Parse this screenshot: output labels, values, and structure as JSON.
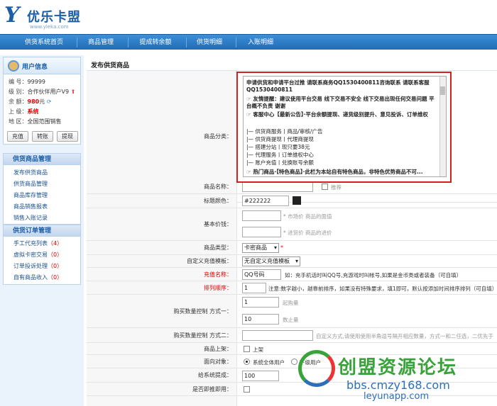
{
  "header": {
    "logo_mark": "Y",
    "logo_text": "优乐卡盟",
    "logo_sub": "www.yleka.com"
  },
  "nav": {
    "items": [
      "供货系统首页",
      "商品管理",
      "提成转余额",
      "供货明细",
      "入账明细"
    ]
  },
  "user_panel": {
    "title": "用户信息",
    "rows": [
      {
        "k": "编 号：",
        "v": "99999"
      },
      {
        "k": "级 别：",
        "v": "合作伙伴用户V9"
      },
      {
        "k": "余 额：",
        "v": "980",
        "unit": "元"
      },
      {
        "k": "上 级：",
        "v": "系统"
      },
      {
        "k": "地 区：",
        "v": "全国范围销售"
      }
    ],
    "buttons": [
      "充值",
      "转账",
      "提现"
    ]
  },
  "menu_goods": {
    "title": "供货商品管理",
    "items": [
      {
        "label": "发布供货商品"
      },
      {
        "label": "供货商品管理"
      },
      {
        "label": "商品库存管理"
      },
      {
        "label": "商品销售报表"
      },
      {
        "label": "销售入账记录"
      }
    ]
  },
  "menu_orders": {
    "title": "供货订单管理",
    "items": [
      {
        "label": "手工代充列表",
        "count": "（4）"
      },
      {
        "label": "虚拟卡密交易",
        "count": "（0）"
      },
      {
        "label": "订单投诉处理",
        "count": "（0）"
      },
      {
        "label": "自有商品收入",
        "count": "（0）"
      }
    ]
  },
  "page_title": "发布供货商品",
  "category": {
    "label": "商品分类：",
    "lines": [
      "申请供货和申请平台过推 请联系商务QQ1530400811咨询联系 请联系客服QQ1530400811",
      "☞ 友情提醒：建议使用平台交易 线下交易不安全 线下交易出现任何交易问题 平台概不负责 谢谢",
      "☞ 客服中心【最新公告】·平台余额提现、递货级别提升、意见投诉、订单维权",
      "|— 供货商服务丨商品/审核/广告",
      "|— 供货商提现丨代理商提现",
      "|— 搭建分站丨现只要38元",
      "|— 代理服务丨订单维权中心",
      "|— 账户充值丨兑换账号余额",
      "☞ 热门商品·【特色商品】·此栏为本站自有特色商品，非特色优势商品不可..."
    ]
  },
  "form": {
    "name_label": "商品名称：",
    "name_hint": "推荐",
    "color_label": "标题颜色：",
    "color_value": "#222222",
    "price_label": "基本价钱：",
    "market_hint": "* 市场价 商品的面值",
    "cost_hint": "* 进货价 商品的进价",
    "type_label": "商品类型：",
    "type_value": "卡密商品",
    "tpl_label": "自定义充值模板：",
    "tpl_value": "无自定义充值模板",
    "recharge_label": "充值名称：",
    "recharge_value": "QQ号码",
    "recharge_hint": "如：充手机话时叫QQ号,充游戏时叫帐号,如果是金币类或者装备（可自填）",
    "sort_label": "排列顺序：",
    "sort_value": "1",
    "sort_hint": "注意:数字越小，越靠前排序，如果没有特殊要求，填1即可，默认按添加时间排序排列（可自填）",
    "qty1_label": "购买数量控制 方式一：",
    "qty1_min": "1",
    "qty1_min_hint": "起购量",
    "qty1_max": "10",
    "qty1_max_hint": "数止量",
    "qty2_label": "购买数量控制 方式二：",
    "qty2_hint": "自定义方式,请使用使用半角逗号隔开相应数量，方式一和二任选，二优先于",
    "shelf_label": "商品上架：",
    "shelf_text": "上架",
    "target_label": "面向对象：",
    "target_all": "系统全体用户",
    "target_other": "下级用户",
    "commission_label": "给系统提成：",
    "commission_value": "100",
    "promo_label": "是否即推即用："
  },
  "watermark": {
    "cn": "创盟资源论坛",
    "url1": "bbs.cmzy168.com",
    "url2": "leyunapp.com"
  }
}
